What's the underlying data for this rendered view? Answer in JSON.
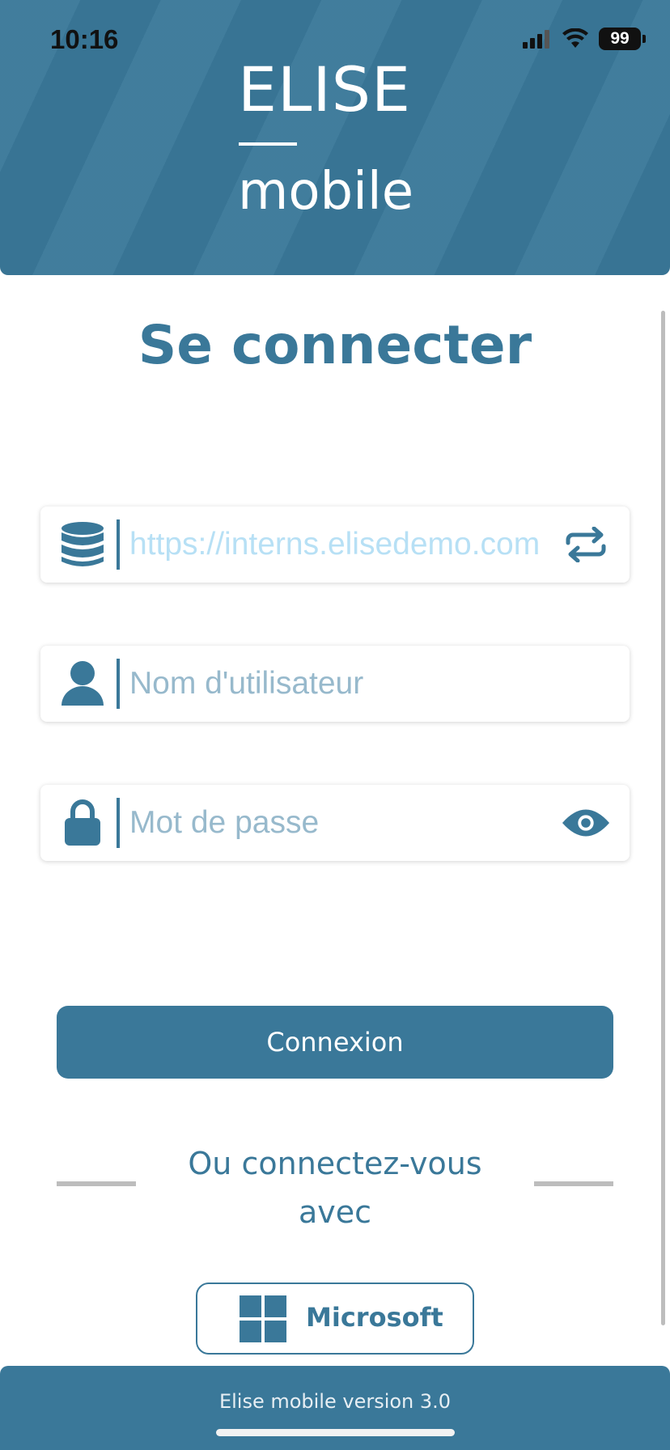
{
  "status_bar": {
    "time": "10:16",
    "battery": "99",
    "icons": [
      "cellular-signal-icon",
      "wifi-icon",
      "battery-icon"
    ]
  },
  "header": {
    "app_name": "ELISE",
    "app_subtitle": "mobile",
    "background_color": "#3a7899"
  },
  "login": {
    "title": "Se connecter",
    "server_field": {
      "placeholder": "https://interns.elisedemo.com",
      "icon": "database-icon",
      "action_icon": "switch-server-icon"
    },
    "username_field": {
      "placeholder": "Nom d'utilisateur",
      "icon": "user-icon"
    },
    "password_field": {
      "placeholder": "Mot de passe",
      "icon": "lock-icon",
      "action_icon": "eye-icon"
    },
    "submit_label": "Connexion",
    "alt_login_text": "Ou connectez-vous avec",
    "microsoft_label": "Microsoft"
  },
  "footer": {
    "version_text": "Elise mobile version 3.0"
  },
  "colors": {
    "accent": "#3a7899",
    "placeholder": "#97b9cc",
    "server_placeholder": "#b7e0f5",
    "divider_gray": "#bdbdbd"
  }
}
